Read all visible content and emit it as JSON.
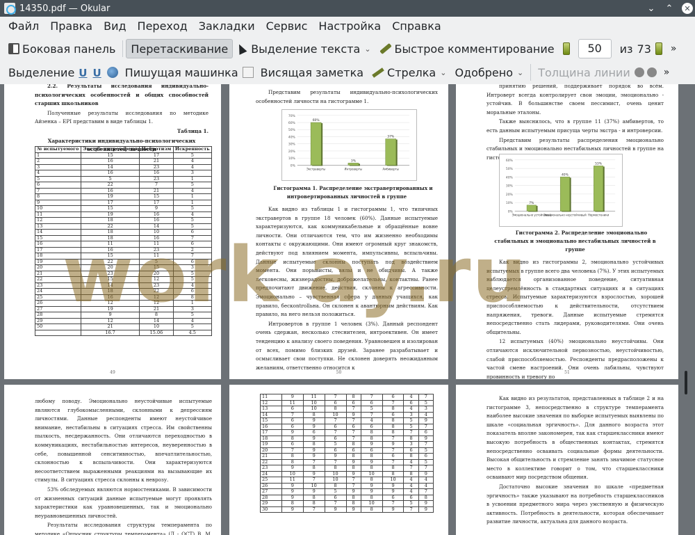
{
  "window": {
    "title": "14350.pdf  — Okular"
  },
  "menu": [
    "Файл",
    "Правка",
    "Вид",
    "Переход",
    "Закладки",
    "Сервис",
    "Настройка",
    "Справка"
  ],
  "toolbar1": {
    "sidebar": "Боковая панель",
    "drag": "Перетаскивание",
    "text_select": "Выделение текста",
    "quick_comment": "Быстрое комментирование",
    "page_current": "50",
    "page_of": "из",
    "page_total": "73"
  },
  "toolbar2": {
    "highlight": "Выделение",
    "typewriter": "Пишущая машинка",
    "popup_note": "Висящая заметка",
    "arrow": "Стрелка",
    "approved": "Одобрено",
    "line_width": "Толщина линии"
  },
  "watermark": "work   ay.ru",
  "page1": {
    "heading": "2.2.  Результаты  исследования  индивидуально-психологических особенностей и общих способностей старших школьников",
    "intro": "Полученные результаты исследования по методике Айзенка – EPI представим в виде таблицы 1.",
    "table_label": "Таблица 1.",
    "table_title": "Характеристики индивидуально-психологических особенностей личности",
    "columns": [
      "№ испытуемого",
      "Экстра-интроверсия",
      "Нейротизм",
      "Искренность"
    ],
    "rows": [
      [
        "1",
        "15",
        "17",
        "5"
      ],
      [
        "2",
        "16",
        "21",
        "4"
      ],
      [
        "3",
        "14",
        "23",
        "4"
      ],
      [
        "4",
        "16",
        "16",
        "3"
      ],
      [
        "5",
        "5",
        "23",
        "1"
      ],
      [
        "6",
        "22",
        "7",
        "5"
      ],
      [
        "7",
        "16",
        "21",
        "4"
      ],
      [
        "8",
        "19",
        "15",
        "1"
      ],
      [
        "9",
        "17",
        "17",
        "1"
      ],
      [
        "10",
        "15",
        "9",
        "5"
      ],
      [
        "11",
        "19",
        "16",
        "4"
      ],
      [
        "12",
        "18",
        "16",
        "5"
      ],
      [
        "13",
        "22",
        "14",
        "5"
      ],
      [
        "14",
        "18",
        "10",
        "6"
      ],
      [
        "15",
        "18",
        "16",
        "7"
      ],
      [
        "16",
        "11",
        "11",
        "6"
      ],
      [
        "17",
        "16",
        "23",
        "2"
      ],
      [
        "18",
        "15",
        "11",
        "7"
      ],
      [
        "19",
        "22",
        "5",
        "6"
      ],
      [
        "20",
        "20",
        "15",
        "3"
      ],
      [
        "21",
        "23",
        "20",
        "5"
      ],
      [
        "22",
        "15",
        "12",
        "5"
      ],
      [
        "23",
        "14",
        "23",
        "4"
      ],
      [
        "24",
        "18",
        "22",
        "6"
      ],
      [
        "25",
        "16",
        "12",
        "8"
      ],
      [
        "26",
        "12",
        "12",
        "1"
      ],
      [
        "27",
        "19",
        "21",
        "3"
      ],
      [
        "28",
        "9",
        "8",
        "5"
      ],
      [
        "29",
        "12",
        "14",
        "4"
      ],
      [
        "50",
        "21",
        "10",
        "5"
      ],
      [
        "",
        "16.7",
        "15.06",
        "4.5"
      ]
    ],
    "num": "49"
  },
  "page2": {
    "intro": "Представим результаты индивидуально-психологических особенностей личности на гистограмме 1.",
    "caption": "Гистограмма 1. Распределение экстравертированных и интровертированных личностей в группе",
    "paragraphs": [
      "Как видно из таблицы 1 и гистограммы 1, что типичных экстравертов в группе 18 человек (60%). Данные испытуемые характеризуются, как коммуникабельные и обращённые вовне личности. Они отличаются тем, что им жизненно необходимы контакты с окружающими. Они имеют огромный круг знакомств, действуют под влиянием момента, импульсивны, вспыльчивы. Данные испытуемые склонны поступать под воздействием момента. Они порывисты, вялы и не обидчивы. А также легковесны, жизнерадостны, доброжелательны, контактны. Ранее предпочитают движение, действия, склонны к агрессивности. Эмоционально – чувственная сфера у данных учащихся, как правило, бескontrollьна. Он склонен к авантюрным действиям. Как правило, на него нельзя положиться.",
      "Интровертов в группе 1 человек (3%). Данный респондент очень сдержан, несколько стеснителен, интроективен. Он имеет тенденцию к анализу своего поведения. Уравновешен и изолирован от всех, помимо близких друзей. Заранее разрабатывает и осмысливает свои поступки. Не склонен доверять неожиданным желаниям, ответственно относится к"
    ],
    "num": "50"
  },
  "page3": {
    "top_paragraphs": [
      "принятию решений, поддерживает порядок во всём. Интроверт всегда контролирует свои эмоции, эмоционально - устойчив. В большинстве своем пессимист, очень ценит моральные эталоны.",
      "Также выяснилось, что в группе 11 (37%) амбивертов, то есть данным испытуемым присуща черты экстра - и интроверсии.",
      "Представим результаты распределения эмоционально стабильных и эмоционально нестабильных личностей в группе на гистограмме 2."
    ],
    "caption": "Гистограмма 2. Распределение эмоционально стабильных и эмоционально нестабильных личностей в группе",
    "paragraphs": [
      "Как видно из гистограммы 2, эмоционально устойчивых испытуемых в группе всего два человека (7%). У этих испытуемых наблюдается организованное поведение, ситуативная целеустремлённость в стандартных ситуациях и в ситуациях стресса. Испытуемые характеризуются взрослостью, хорошей приспособляемостью к действительности, отсутствием напряжения, тревоги. Данные испытуемые стремятся непосредственно стать лидерами, руководителями. Они очень общительны.",
      "12 испытуемых (40%) эмоционально неустойчивы. Они отличаются исключительной первозностью, неустойчивостью, слабой приспособляемостью. Респонденты предрасположены к частой смене настроений. Они очень лабильны, чувствуют провинность и тревогу по"
    ],
    "num": "51"
  },
  "page4": {
    "paragraphs": [
      "любому поводу. Эмоционально неустойчивые испытуемые являются глубокомысленными, склонными к депрессиям личностями. Данные респонденты имеют неустойчивое внимание, нестабильны в ситуациях стресса. Им свойственны пылкость, несдержанность. Они отличаются переходностью в коммуникациях, нестабильностью интересов, неуверенностью в себе, повышенной сенситивностью, впечатлительностью, склонностью к вспыльчивости. Они характеризуются несоответствием выраженными реакциями на вызывающие их стимулы. В ситуациях стресса склонны к неврозу.",
      "53% обследуемых являются нормостениками. В зависимости от жизненных ситуаций данные испытуемые могут проявлять характеристики как уравновешенных, так и эмоционально неуравновешенных личностей.",
      "Результаты исследования структуры темперамента по методике «Опросник структуры темперамента» (Д - ОСТ) В. М. Русалова"
    ]
  },
  "page5": {
    "rows": [
      [
        "11",
        "9",
        "11",
        "7",
        "8",
        "7",
        "6",
        "4",
        "7"
      ],
      [
        "12",
        "11",
        "10",
        "6",
        "6",
        "6",
        "7",
        "6",
        "5"
      ],
      [
        "13",
        "6",
        "10",
        "8",
        "7",
        "5",
        "8",
        "4",
        "3"
      ],
      [
        "14",
        "7",
        "8",
        "10",
        "9",
        "7",
        "6",
        "3",
        "4"
      ],
      [
        "15",
        "6",
        "9",
        "7",
        "7",
        "4",
        "8",
        "5",
        "9"
      ],
      [
        "16",
        "6",
        "9",
        "6",
        "6",
        "6",
        "8",
        "5",
        "7"
      ],
      [
        "17",
        "9",
        "6",
        "7",
        "7",
        "8",
        "8",
        "7",
        "6"
      ],
      [
        "18",
        "8",
        "9",
        "6",
        "7",
        "8",
        "7",
        "8",
        "9"
      ],
      [
        "19",
        "6",
        "8",
        "5",
        "8",
        "9",
        "9",
        "3",
        "7"
      ],
      [
        "20",
        "7",
        "9",
        "6",
        "6",
        "6",
        "7",
        "6",
        "5"
      ],
      [
        "21",
        "8",
        "9",
        "9",
        "8",
        "8",
        "6",
        "8",
        "6"
      ],
      [
        "22",
        "8",
        "7",
        "7",
        "9",
        "9",
        "7",
        "4",
        "5"
      ],
      [
        "23",
        "9",
        "8",
        "8",
        "8",
        "8",
        "8",
        "7",
        "7"
      ],
      [
        "24",
        "10",
        "9",
        "10",
        "9",
        "10",
        "8",
        "8",
        "9"
      ],
      [
        "25",
        "11",
        "7",
        "10",
        "7",
        "8",
        "10",
        "4",
        "4"
      ],
      [
        "26",
        "9",
        "10",
        "8",
        "7",
        "9",
        "9",
        "4",
        "4"
      ],
      [
        "27",
        "9",
        "9",
        "5",
        "9",
        "9",
        "9",
        "4",
        "7"
      ],
      [
        "28",
        "9",
        "8",
        "6",
        "8",
        "8",
        "6",
        "6",
        "8"
      ],
      [
        "29",
        "8",
        "8",
        "7",
        "8",
        "10",
        "7",
        "5",
        "9"
      ],
      [
        "30",
        "9",
        "7",
        "9",
        "9",
        "8",
        "9",
        "7",
        "9"
      ]
    ]
  },
  "page6": {
    "paragraphs": [
      "Как видно из результатов, представленных в таблице 2 и на гистограмме 3, непосредственно в структуре темперамента наиболее высокие значения по выборке испытуемых выявлены по шкале «социальная эргичность». Для данного возраста этот показатель вполне закономерен, так как старшеклассники имеют высокую потребность в общественных контактах, стремятся непосредственно осваивать социальные формы деятельности. Высокая общительность и стремление занять значимое статусное место в коллективе говорит о том, что старшеклассники осваивают мир посредством общения.",
      "Достаточно высокие значения по шкале «предметная эргичность» также указывают на потребность старшеклассников в усвоении предметного мира через умственную и физическую активность. Потребность в деятельности, которая обеспечивает развитие личности, актуальна для данного возраста."
    ]
  },
  "chart_data": [
    {
      "type": "bar",
      "categories": [
        "Экстраверты",
        "Интроверты",
        "Амбиверты"
      ],
      "values": [
        60,
        3,
        37
      ],
      "data_labels": [
        "60%",
        "3%",
        "37%"
      ],
      "yticks": [
        "0%",
        "10%",
        "20%",
        "30%",
        "40%",
        "50%",
        "60%",
        "70%"
      ],
      "ylim": [
        0,
        70
      ],
      "color": "#9bbb59"
    },
    {
      "type": "bar",
      "categories": [
        "Эмоционально устойчивый",
        "Эмоционально неустойчивый",
        "Нормостеники"
      ],
      "values": [
        7,
        40,
        53
      ],
      "data_labels": [
        "7%",
        "40%",
        "53%"
      ],
      "yticks": [
        "0%",
        "10%",
        "20%",
        "30%",
        "40%",
        "50%",
        "60%"
      ],
      "ylim": [
        0,
        60
      ],
      "color": "#9bbb59"
    }
  ]
}
